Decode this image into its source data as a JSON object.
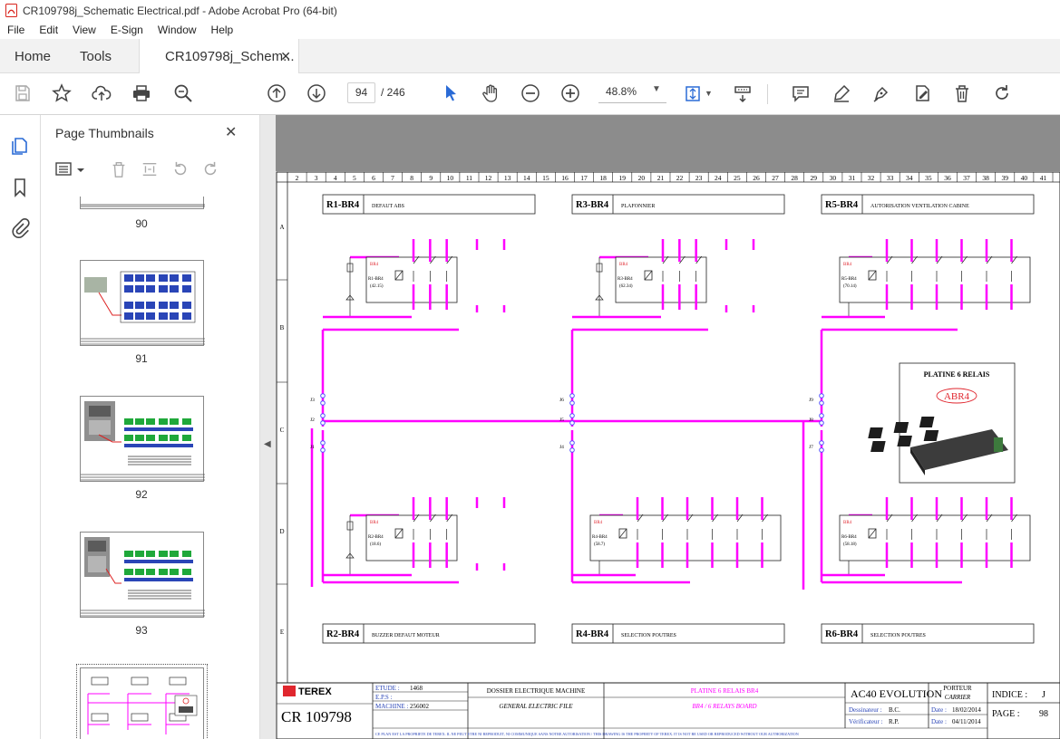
{
  "window": {
    "title": "CR109798j_Schematic Electrical.pdf - Adobe Acrobat Pro (64-bit)"
  },
  "menu": [
    "File",
    "Edit",
    "View",
    "E-Sign",
    "Window",
    "Help"
  ],
  "tabs": {
    "home": "Home",
    "tools": "Tools",
    "document": "CR109798j_Schem..."
  },
  "toolbar": {
    "page_current": "94",
    "page_total": "/ 246",
    "zoom": "48.8%"
  },
  "panel": {
    "title": "Page Thumbnails"
  },
  "thumbnails": [
    {
      "label": "90"
    },
    {
      "label": "91"
    },
    {
      "label": "92"
    },
    {
      "label": "93"
    }
  ],
  "schematic": {
    "columns": [
      "2",
      "3",
      "4",
      "5",
      "6",
      "7",
      "8",
      "9",
      "10",
      "11",
      "12",
      "13",
      "14",
      "15",
      "16",
      "17",
      "18",
      "19",
      "20",
      "21",
      "22",
      "23",
      "24",
      "25",
      "26",
      "27",
      "28",
      "29",
      "30",
      "31",
      "32",
      "33",
      "34",
      "35",
      "36",
      "37",
      "38",
      "39",
      "40",
      "41"
    ],
    "rows": [
      "A",
      "B",
      "C",
      "D",
      "E"
    ],
    "relays": [
      {
        "id": "R1-BR4",
        "desc": "DEFAUT ABS",
        "coil": "R1-BR4",
        "value": "(42.15)"
      },
      {
        "id": "R3-BR4",
        "desc": "PLAFONNIER",
        "coil": "R3-BR4",
        "value": "(62.34)"
      },
      {
        "id": "R5-BR4",
        "desc": "AUTORISATION VENTILATION CABINE",
        "coil": "R5-BR4",
        "value": "(70.14)"
      },
      {
        "id": "R2-BR4",
        "desc": "BUZZER DEFAUT MOTEUR",
        "coil": "R2-BR4",
        "value": "(18.6)"
      },
      {
        "id": "R4-BR4",
        "desc": "SELECTION POUTRES",
        "coil": "R4-BR4",
        "value": "(58.7)"
      },
      {
        "id": "R6-BR4",
        "desc": "SELECTION POUTRES",
        "coil": "R6-BR4",
        "value": "(58.18)"
      }
    ],
    "relay_tag": "BR4",
    "board_label": "PLATINE 6 RELAIS",
    "board_badge": "ABR4",
    "junctions": [
      "J3",
      "J2",
      "J1",
      "J6",
      "J5",
      "J4",
      "J9",
      "J8",
      "J7"
    ],
    "title_block": {
      "logo": "TEREX",
      "doc_number": "CR 109798",
      "etude_label": "ETUDE :",
      "etude_value": "1468",
      "eps_label": "E.P.S :",
      "machine_label": "MACHINE :",
      "machine_value": "256002",
      "dossier": "DOSSIER ELECTRIQUE MACHINE",
      "file": "GENERAL ELECTRIC FILE",
      "platine": "PLATINE 6 RELAIS BR4",
      "board": "BR4 / 6 RELAYS BOARD",
      "model": "AC40 EVOLUTION",
      "porteur": "PORTEUR",
      "carrier": "CARRIER",
      "dessinateur_label": "Dessinateur :",
      "dessinateur_value": "B.C.",
      "verificateur_label": "Vérificateur :",
      "verificateur_value": "R.P.",
      "date_label": "Date :",
      "date1": "18/02/2014",
      "date2": "04/11/2014",
      "indice_label": "INDICE :",
      "indice_value": "J",
      "page_label": "PAGE :",
      "page_value": "98",
      "notice": "CE PLAN EST LA PROPRIETE DE TEREX. IL NE PEUT ETRE NI REPRODUIT, NI COMMUNIQUE SANS NOTRE AUTORISATION / THIS DRAWING IS THE PROPERTY OF TEREX. IT IS NOT BE USED OR REPRODUCED WITHOUT OUR AUTHORIZATION"
    }
  },
  "colors": {
    "wire": "#ff00ff",
    "accent": "#2a6bd6",
    "panel_bg": "#f2f2f2",
    "viewer_bg": "#8c8c8c",
    "stamp_red": "#e0262e"
  }
}
